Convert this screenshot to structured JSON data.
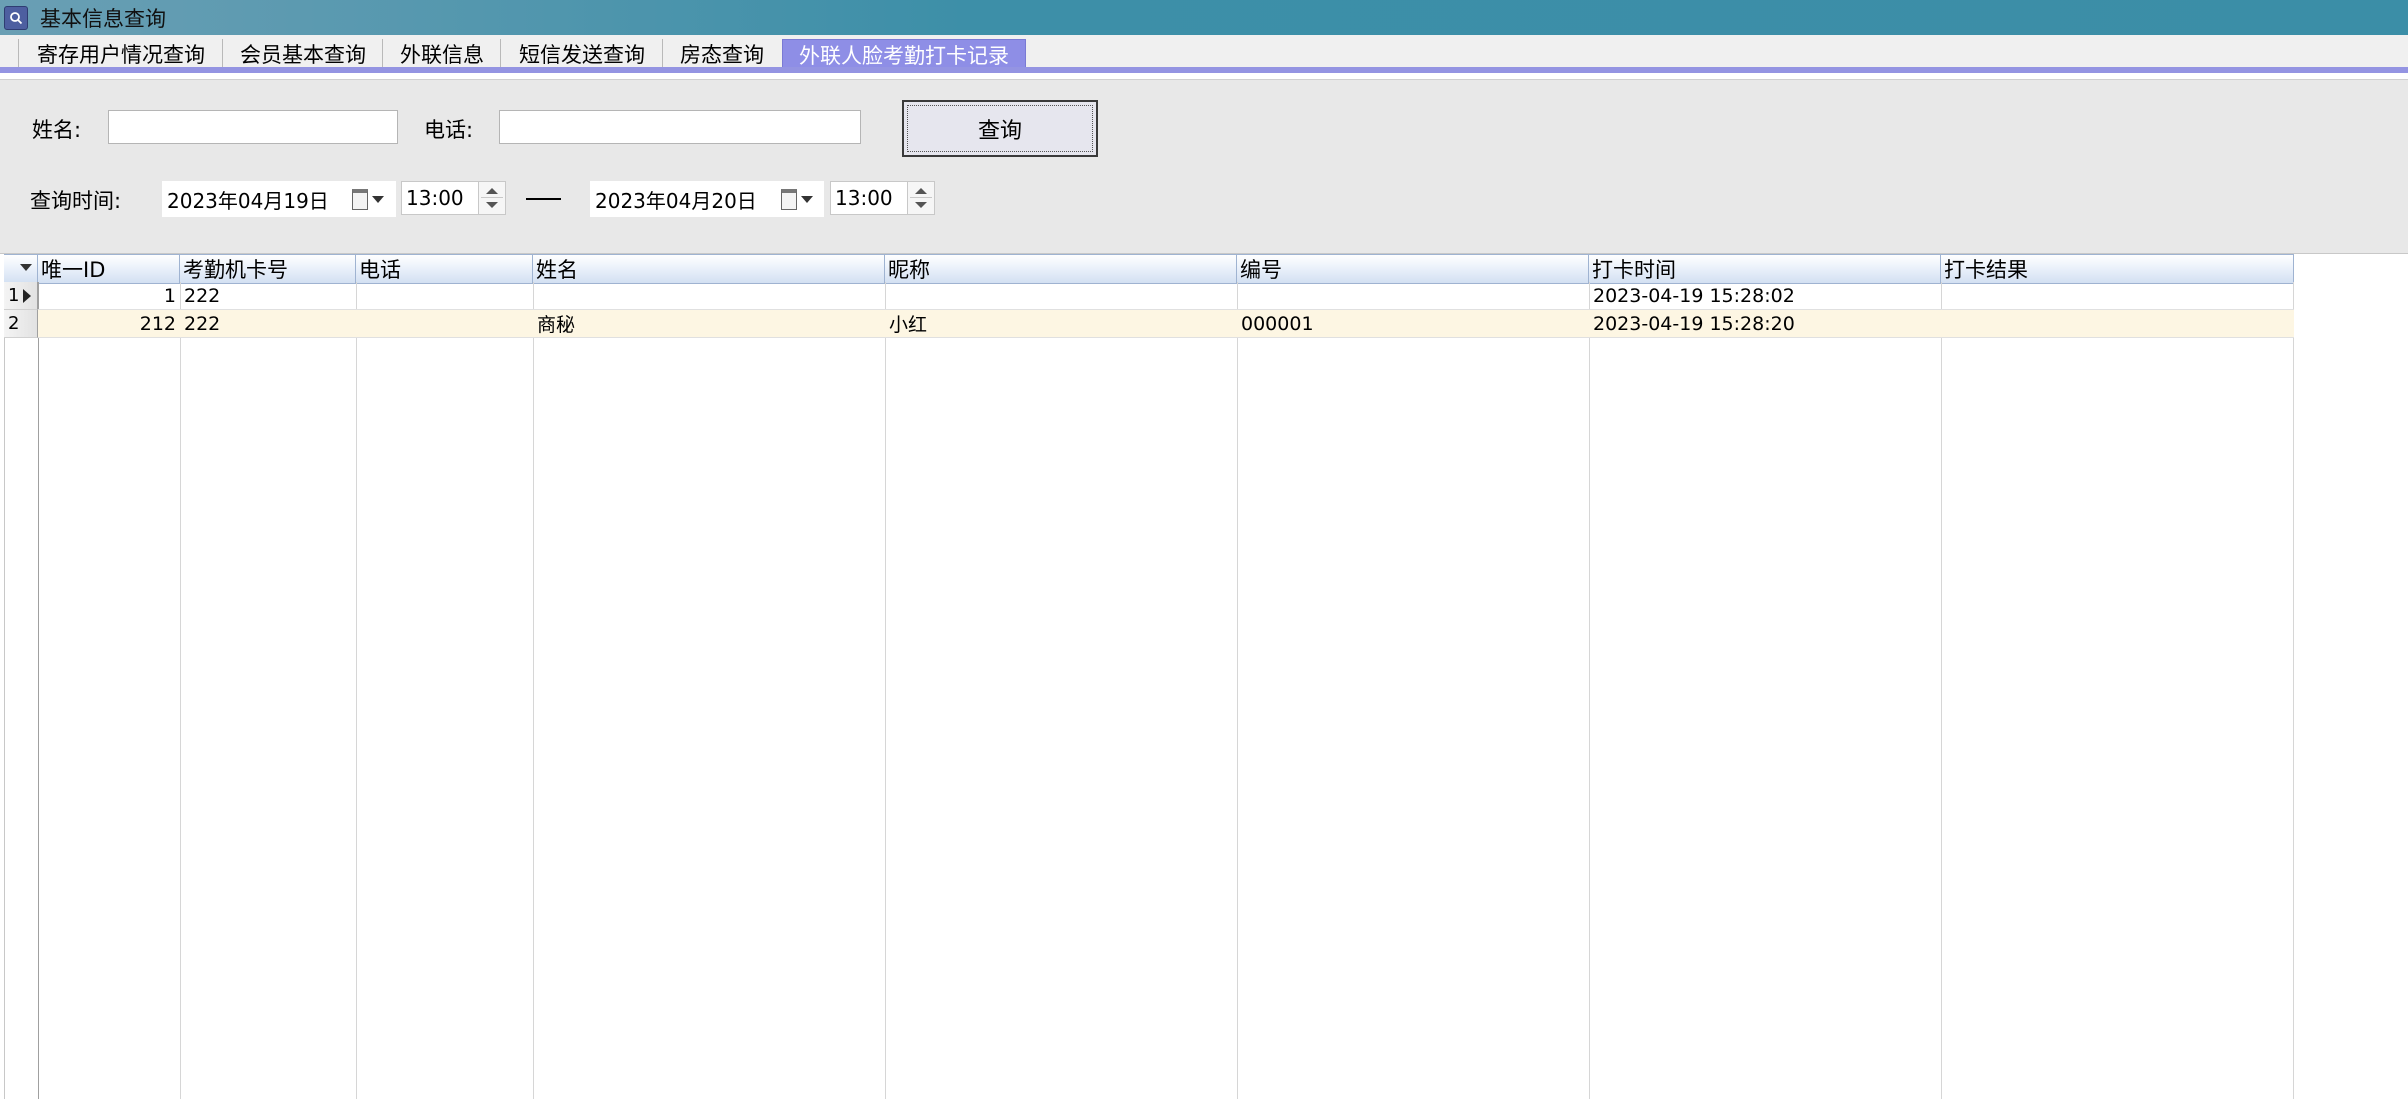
{
  "window": {
    "title": "基本信息查询",
    "icon": "search-icon"
  },
  "tabs": [
    {
      "label": "寄存用户情况查询",
      "active": false
    },
    {
      "label": "会员基本查询",
      "active": false
    },
    {
      "label": "外联信息",
      "active": false
    },
    {
      "label": "短信发送查询",
      "active": false
    },
    {
      "label": "房态查询",
      "active": false
    },
    {
      "label": "外联人脸考勤打卡记录",
      "active": true
    }
  ],
  "filters": {
    "name_label": "姓名:",
    "name_value": "",
    "phone_label": "电话:",
    "phone_value": "",
    "query_button": "查询",
    "time_label": "查询时间:",
    "start_date": "2023年04月19日",
    "start_time": "13:00",
    "end_date": "2023年04月20日",
    "end_time": "13:00"
  },
  "table": {
    "columns": [
      "唯一ID",
      "考勤机卡号",
      "电话",
      "姓名",
      "昵称",
      "编号",
      "打卡时间",
      "打卡结果"
    ],
    "rows": [
      {
        "index": "1",
        "current": true,
        "cells": [
          "1",
          "222",
          "",
          "",
          "",
          "",
          "2023-04-19 15:28:02",
          ""
        ]
      },
      {
        "index": "2",
        "current": false,
        "cells": [
          "212",
          "222",
          "",
          "商秘",
          "小红",
          "000001",
          "2023-04-19 15:28:20",
          ""
        ]
      }
    ]
  },
  "colors": {
    "titlebar": "#3b8ea7",
    "active_tab": "#8e8ee6",
    "alt_row": "#fdf6e3"
  }
}
